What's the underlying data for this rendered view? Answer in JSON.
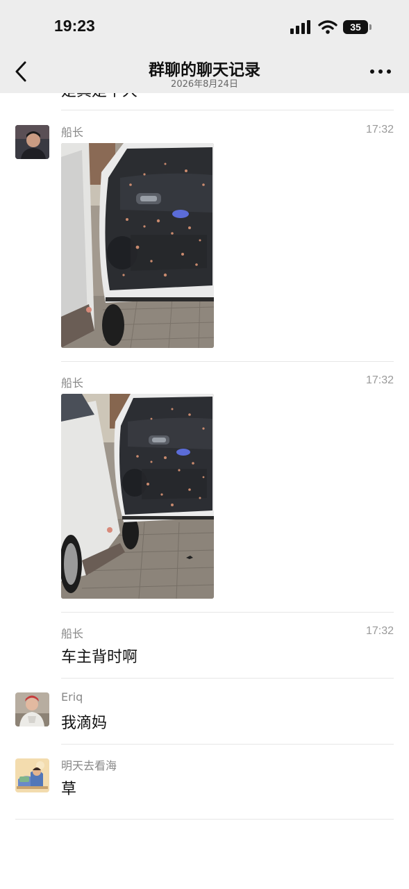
{
  "status_bar": {
    "time": "19:23",
    "battery": "35"
  },
  "header": {
    "title": "群聊的聊天记录",
    "date": "2026年8月24日"
  },
  "previous_message_partial": "是真是中大",
  "messages": [
    {
      "sender": "船长",
      "time": "17:32",
      "type": "image",
      "avatar_icon": "user-photo-avatar",
      "image_icon": "damaged-car-door-photo"
    },
    {
      "sender": "船长",
      "time": "17:32",
      "type": "image",
      "image_icon": "damaged-car-door-photo"
    },
    {
      "sender": "船长",
      "time": "17:32",
      "type": "text",
      "text": "车主背时啊"
    },
    {
      "sender": "Eriq",
      "time": "",
      "type": "text",
      "text": "我滴妈",
      "avatar_icon": "user-photo-avatar"
    },
    {
      "sender": "明天去看海",
      "time": "",
      "type": "text",
      "text": "草",
      "avatar_icon": "cartoon-avatar"
    }
  ],
  "colors": {
    "header_bg": "#ededed",
    "page_bg": "#ffffff",
    "meta_text": "#888888",
    "divider": "#e6e6e6"
  }
}
